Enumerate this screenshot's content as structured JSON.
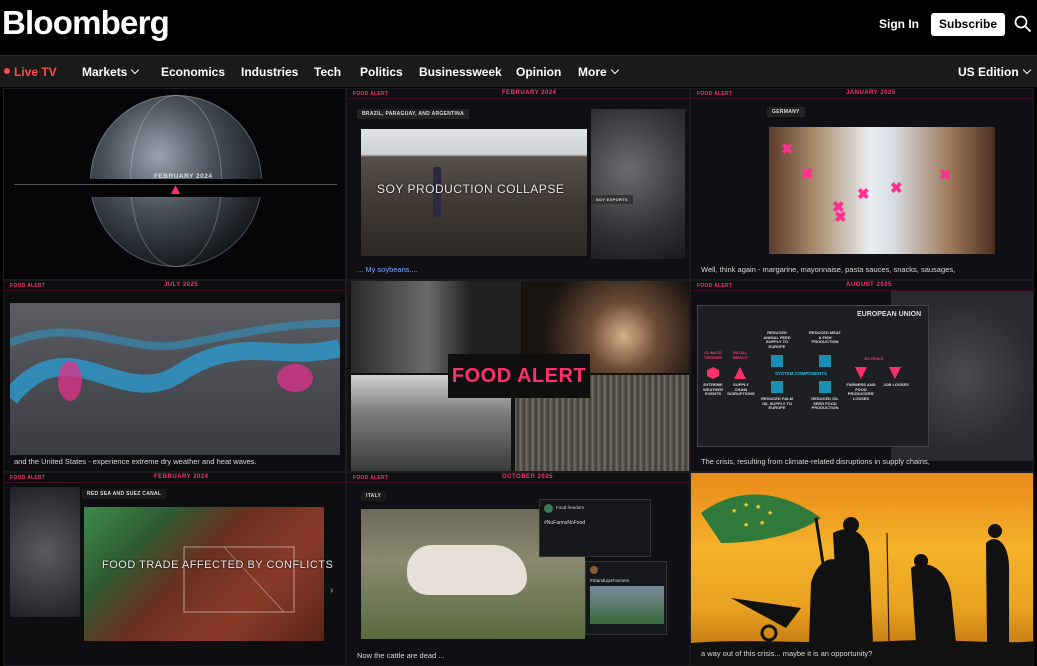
{
  "header": {
    "logo": "Bloomberg",
    "sign_in": "Sign In",
    "subscribe": "Subscribe"
  },
  "nav": {
    "live_tv": "Live TV",
    "items": [
      "Markets",
      "Economics",
      "Industries",
      "Tech",
      "Politics",
      "Businessweek",
      "Opinion",
      "More"
    ],
    "edition": "US Edition"
  },
  "collage": {
    "tag": "FOOD ALERT",
    "tiles": {
      "globe": {
        "date": "FEBRUARY 2024"
      },
      "soy": {
        "date": "FEBRUARY 2024",
        "location": "BRAZIL, PARAGUAY, AND ARGENTINA",
        "title": "SOY PRODUCTION COLLAPSE",
        "caption": "... My soybeans....",
        "map_badge": "SOY EXPORTS"
      },
      "germany": {
        "date": "JANUARY 2025",
        "location": "GERMANY",
        "caption": "Well, think again - margarine, mayonnaise, pasta sauces, snacks, sausages,"
      },
      "map_heat": {
        "date": "JULY 2025",
        "caption": "and the United States - experience extreme dry weather and heat waves."
      },
      "center": {
        "title": "FOOD ALERT"
      },
      "eu": {
        "date": "AUGUST 2025",
        "region": "EUROPEAN UNION",
        "caption": "The crisis, resulting from climate-related disruptions in supply chains,",
        "diagram": {
          "climate_trigger": "CLIMATE TRIGGER",
          "initial_impact": "INITIAL IMPACT",
          "extreme_weather": "EXTREME WEATHER EVENTS",
          "supply_disruptions": "SUPPLY CHAIN DISRUPTIONS",
          "system_components": "SYSTEM COMPONENTS",
          "eu_risks": "EU RISKS",
          "reduced_feed": "REDUCED ANIMAL FEED SUPPLY TO EUROPE",
          "reduced_meat": "REDUCED MEAT & FISH PRODUCTION",
          "reduced_palm": "REDUCED PALM OIL SUPPLY TO EUROPE",
          "reduced_oil": "REDUCED OIL SEED FOOD PRODUCTION",
          "farmers_losses": "FARMERS AND FOOD PRODUCERS' LOSSES",
          "job_losses": "JOB LOSSES"
        }
      },
      "red_sea": {
        "date": "FEBRUARY 2024",
        "location": "RED SEA AND SUEZ CANAL",
        "title": "FOOD TRADE AFFECTED BY CONFLICTS"
      },
      "italy": {
        "date": "OCTOBER 2025",
        "location": "ITALY",
        "caption": "Now the cattle are dead ...",
        "tweet1_header": "Food freedom",
        "tweet1_hashtag": "#NoFarmsNoFood",
        "tweet2_hashtag": "#StandUp4Farmers"
      },
      "eu_flag": {
        "caption": "a way out of this crisis... maybe it is an opportunity?"
      }
    }
  },
  "colors": {
    "accent_pink": "#ff2f6d",
    "live_red": "#ff4b40",
    "diagram_blue": "#1a8fb6"
  }
}
